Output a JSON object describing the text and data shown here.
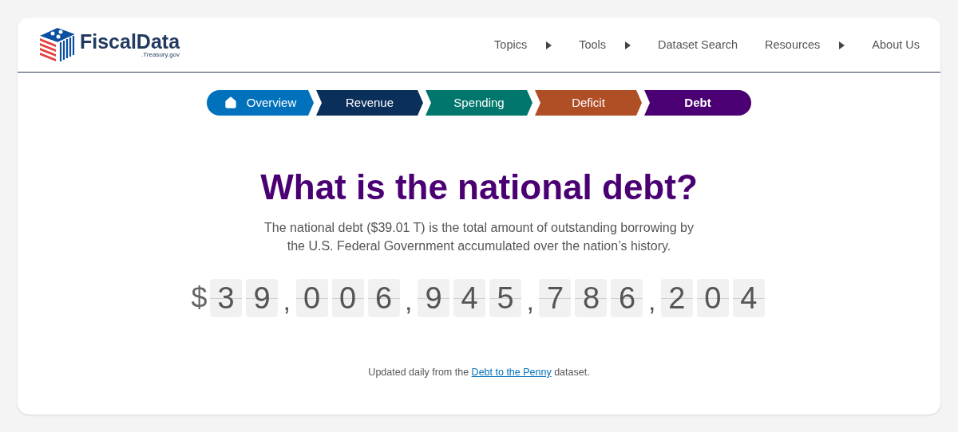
{
  "logo": {
    "name": "FiscalData",
    "domain": ".Treasury.gov"
  },
  "nav": [
    {
      "label": "Topics",
      "has_menu": true
    },
    {
      "label": "Tools",
      "has_menu": true
    },
    {
      "label": "Dataset Search",
      "has_menu": false
    },
    {
      "label": "Resources",
      "has_menu": true
    },
    {
      "label": "About Us",
      "has_menu": false
    }
  ],
  "steps": [
    {
      "label": "Overview",
      "color": "#0071bc",
      "selected": false
    },
    {
      "label": "Revenue",
      "color": "#0a2f5a",
      "selected": false
    },
    {
      "label": "Spending",
      "color": "#00766c",
      "selected": false
    },
    {
      "label": "Deficit",
      "color": "#b04e26",
      "selected": false
    },
    {
      "label": "Debt",
      "color": "#4a0072",
      "selected": true
    }
  ],
  "title": "What is the national debt?",
  "description": "The national debt ($39.01 T) is the total amount of outstanding borrowing by the U.S. Federal Government accumulated over the nation’s history.",
  "counter": {
    "currency": "$",
    "separator": ",",
    "groups": [
      [
        "3",
        "9"
      ],
      [
        "0",
        "0",
        "6"
      ],
      [
        "9",
        "4",
        "5"
      ],
      [
        "7",
        "8",
        "6"
      ],
      [
        "2",
        "0",
        "4"
      ]
    ]
  },
  "footnote": {
    "before": "Updated daily from the ",
    "link": "Debt to the Penny",
    "after": " dataset."
  }
}
